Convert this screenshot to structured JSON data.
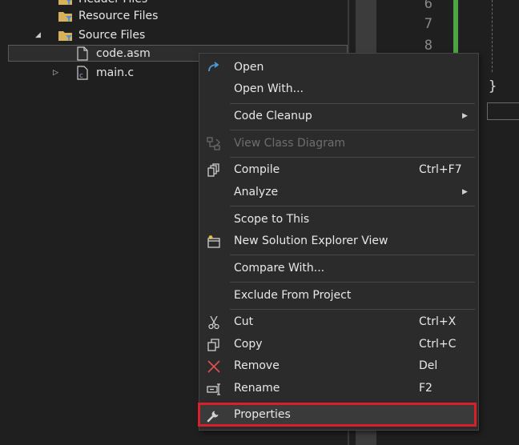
{
  "explorer": {
    "rows": [
      {
        "label": "Header Files"
      },
      {
        "label": "Resource Files"
      },
      {
        "label": "Source Files"
      },
      {
        "label": "code.asm"
      },
      {
        "label": "main.c"
      }
    ]
  },
  "editor": {
    "line_numbers": [
      "6",
      "7",
      "8"
    ],
    "closing_brace": "}"
  },
  "context_menu": {
    "items": [
      {
        "label": "Open",
        "icon": "open-arrow-icon"
      },
      {
        "label": "Open With..."
      },
      {
        "label": "Code Cleanup",
        "submenu": true
      },
      {
        "label": "View Class Diagram",
        "icon": "class-diagram-icon",
        "disabled": true
      },
      {
        "label": "Compile",
        "shortcut": "Ctrl+F7",
        "icon": "compile-icon"
      },
      {
        "label": "Analyze",
        "submenu": true
      },
      {
        "label": "Scope to This"
      },
      {
        "label": "New Solution Explorer View",
        "icon": "new-view-icon"
      },
      {
        "label": "Compare With..."
      },
      {
        "label": "Exclude From Project"
      },
      {
        "label": "Cut",
        "shortcut": "Ctrl+X",
        "icon": "scissors-icon"
      },
      {
        "label": "Copy",
        "shortcut": "Ctrl+C",
        "icon": "copy-icon"
      },
      {
        "label": "Remove",
        "shortcut": "Del",
        "icon": "remove-x-icon"
      },
      {
        "label": "Rename",
        "shortcut": "F2",
        "icon": "rename-icon"
      },
      {
        "label": "Properties",
        "icon": "wrench-icon",
        "highlighted": true
      }
    ]
  },
  "colors": {
    "highlight_border": "#d9202a",
    "change_bar": "#4ea344",
    "remove_icon": "#e05252",
    "open_icon": "#4a9bd9"
  }
}
